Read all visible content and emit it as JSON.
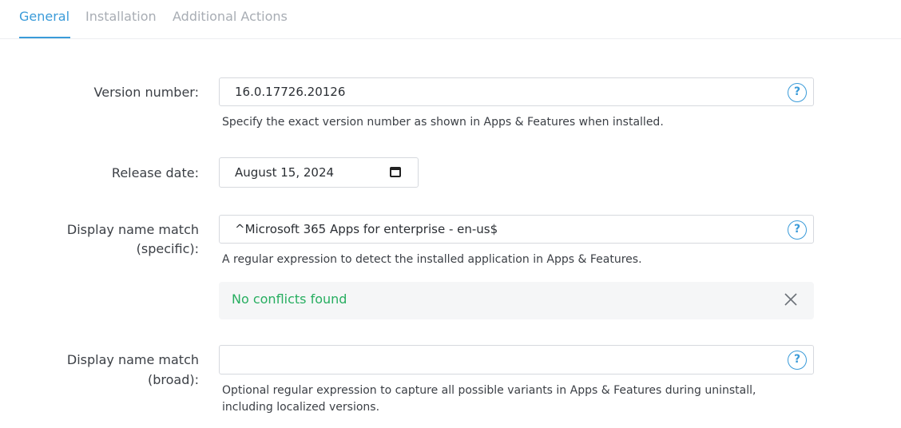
{
  "tabs": [
    {
      "label": "General",
      "active": true
    },
    {
      "label": "Installation",
      "active": false
    },
    {
      "label": "Additional Actions",
      "active": false
    }
  ],
  "version": {
    "label": "Version number:",
    "value": "16.0.17726.20126",
    "hint": "Specify the exact version number as shown in Apps & Features when installed."
  },
  "release": {
    "label": "Release date:",
    "value": "August 15, 2024"
  },
  "specific": {
    "label_line1": "Display name match",
    "label_line2": "(specific):",
    "value": "^Microsoft 365 Apps for enterprise - en-us$",
    "hint": "A regular expression to detect the installed application in Apps & Features."
  },
  "notice": {
    "message": "No conflicts found",
    "color": "#27ae60"
  },
  "broad": {
    "label_line1": "Display name match",
    "label_line2": "(broad):",
    "value": "",
    "hint_line1": "Optional regular expression to capture all possible variants in Apps & Features during uninstall,",
    "hint_line2": "including localized versions."
  },
  "help_glyph": "?",
  "icons": {
    "help": "help-circle-icon",
    "calendar": "calendar-icon",
    "close": "close-icon"
  },
  "colors": {
    "accent": "#3a9bd9",
    "success": "#27ae60"
  }
}
